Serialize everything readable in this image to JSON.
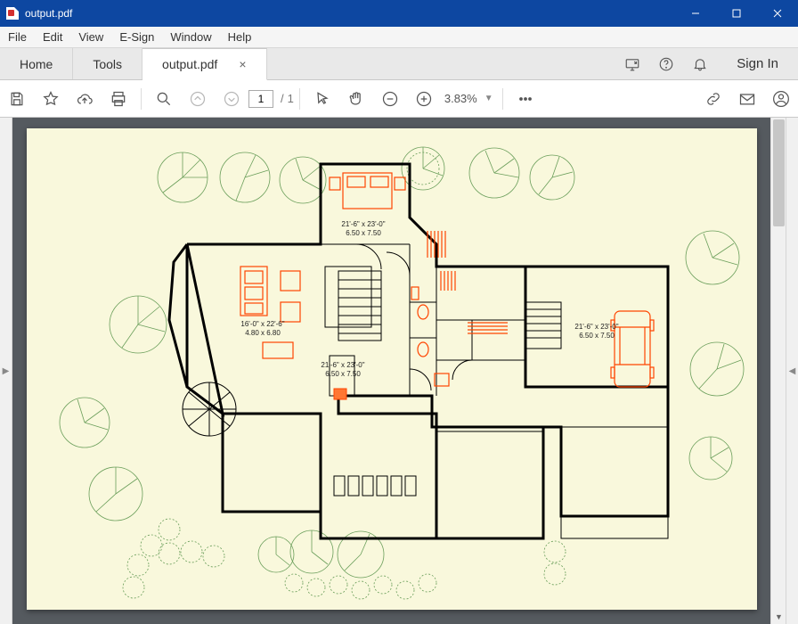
{
  "window": {
    "title": "output.pdf"
  },
  "menu": {
    "items": [
      "File",
      "Edit",
      "View",
      "E-Sign",
      "Window",
      "Help"
    ]
  },
  "tabs": {
    "home": "Home",
    "tools": "Tools",
    "doc": "output.pdf"
  },
  "signin": "Sign In",
  "page_nav": {
    "current": "1",
    "sep": "/",
    "total": "1"
  },
  "zoom": {
    "value": "3.83%"
  },
  "rooms": {
    "r1": {
      "dim": "21'-6\" x 23'-0\"",
      "metric": "6.50 x 7.50"
    },
    "r2": {
      "dim": "16'-0\" x 22'-6\"",
      "metric": "4.80 x 6.80"
    },
    "r3": {
      "dim": "21'-6\" x 23'-0\"",
      "metric": "6.50 x 7.50"
    },
    "r4": {
      "dim": "21'-6\" x 23'-0\"",
      "metric": "6.50 x 7.50"
    }
  }
}
